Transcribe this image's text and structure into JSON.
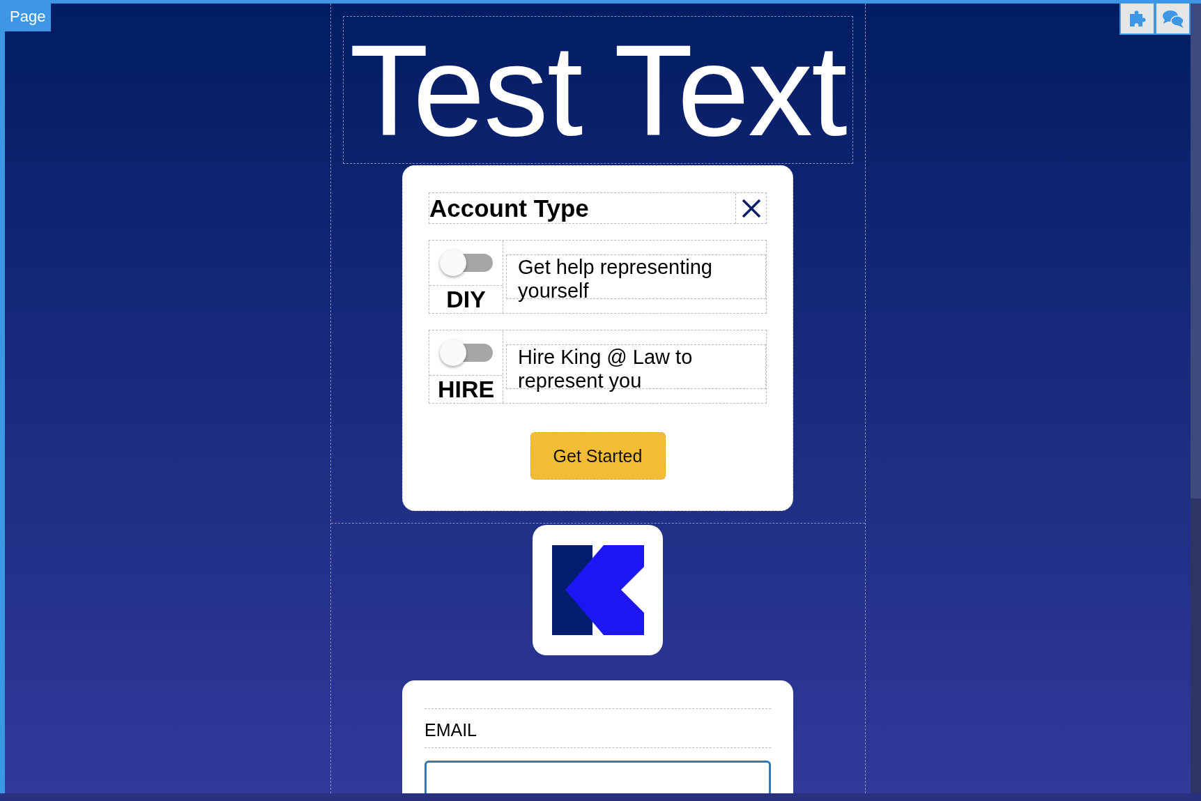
{
  "page_label": "Page",
  "heading": "Test Text",
  "dialog": {
    "title": "Account Type",
    "options": [
      {
        "label": "DIY",
        "description": "Get help representing yourself",
        "on": false
      },
      {
        "label": "HIRE",
        "description": "Hire King @ Law to represent you",
        "on": false
      }
    ],
    "button": "Get Started"
  },
  "form": {
    "fields": [
      {
        "label": "EMAIL"
      }
    ]
  }
}
